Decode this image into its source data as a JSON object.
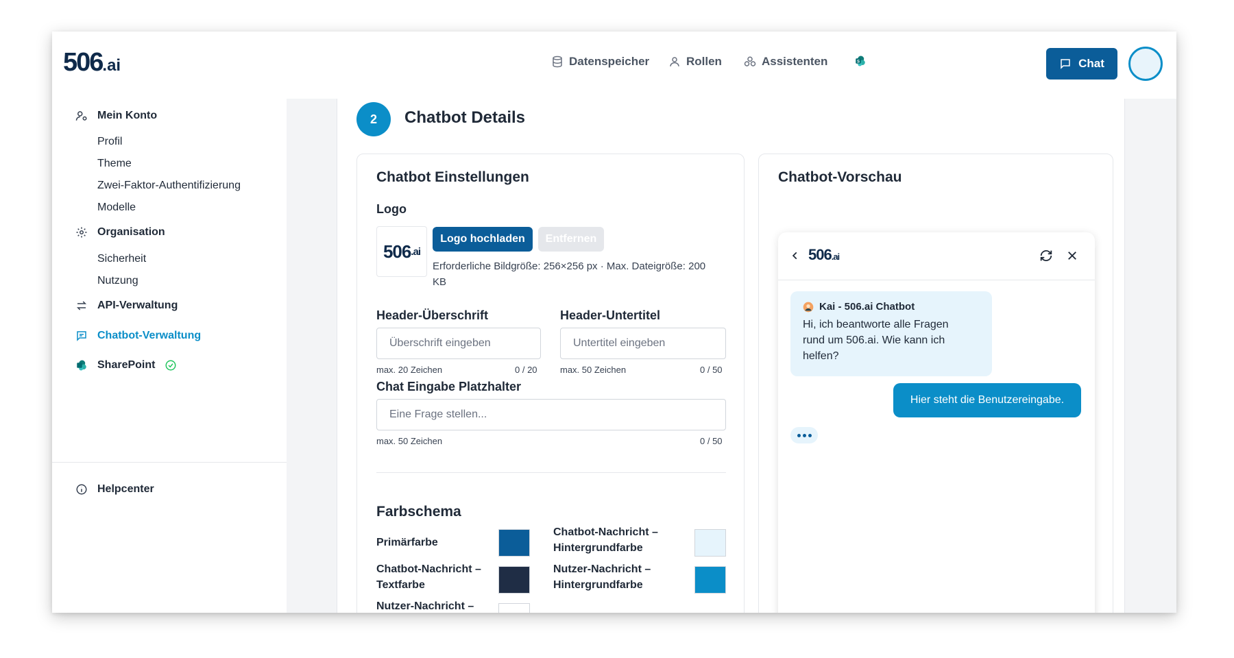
{
  "brand": {
    "main": "506",
    "suffix": ".ai"
  },
  "nav": {
    "datastore": "Datenspeicher",
    "roles": "Rollen",
    "assistants": "Assistenten",
    "chat_button": "Chat"
  },
  "sidebar": {
    "account": "Mein Konto",
    "account_items": [
      "Profil",
      "Theme",
      "Zwei-Faktor-Authentifizierung",
      "Modelle"
    ],
    "organisation": "Organisation",
    "organisation_items": [
      "Sicherheit",
      "Nutzung"
    ],
    "api": "API-Verwaltung",
    "chatbot": "Chatbot-Verwaltung",
    "sharepoint": "SharePoint",
    "helpcenter": "Helpcenter"
  },
  "step": {
    "number": "2",
    "title": "Chatbot Details"
  },
  "settings": {
    "title": "Chatbot Einstellungen",
    "logo_label": "Logo",
    "upload_button": "Logo hochladen",
    "remove_button": "Entfernen",
    "logo_hint": "Erforderliche Bildgröße: 256×256 px · Max. Dateigröße: 200 KB",
    "header_title_label": "Header-Überschrift",
    "header_title_placeholder": "Überschrift eingeben",
    "header_title_max": "max. 20 Zeichen",
    "header_title_count": "0 / 20",
    "header_subtitle_label": "Header-Untertitel",
    "header_subtitle_placeholder": "Untertitel eingeben",
    "header_subtitle_max": "max. 50 Zeichen",
    "header_subtitle_count": "0 / 50",
    "placeholder_label": "Chat Eingabe Platzhalter",
    "placeholder_placeholder": "Eine Frage stellen...",
    "placeholder_max": "max. 50 Zeichen",
    "placeholder_count": "0 / 50",
    "color_scheme_title": "Farbschema",
    "colors": {
      "primary": {
        "label": "Primärfarbe",
        "value": "#0b5d99"
      },
      "bot_text": {
        "label": "Chatbot-Nachricht – Textfarbe",
        "value": "#1f2d45"
      },
      "user_text": {
        "label": "Nutzer-Nachricht –",
        "value": "#ffffff"
      },
      "bot_bg": {
        "label": "Chatbot-Nachricht – Hintergrundfarbe",
        "value": "#e6f4fc"
      },
      "user_bg": {
        "label": "Nutzer-Nachricht – Hintergrundfarbe",
        "value": "#0b8ec8"
      }
    }
  },
  "preview": {
    "title": "Chatbot-Vorschau",
    "bot_name": "Kai - 506.ai Chatbot",
    "bot_message": "Hi, ich beantworte alle Fragen rund um 506.ai. Wie kann ich helfen?",
    "user_message": "Hier steht die Benutzereingabe."
  }
}
